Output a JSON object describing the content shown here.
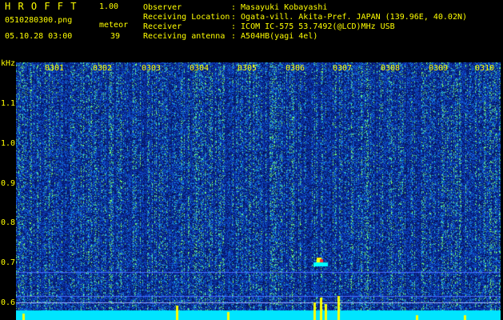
{
  "app": {
    "title": "H R O F F T",
    "version": "1.00",
    "filename": "0510280300.png",
    "datetime": "05.10.28 03:00",
    "meteor_label": "meteor",
    "meteor_count": "39"
  },
  "info": {
    "observer_label": "Observer",
    "observer_value": ": Masayuki Kobayashi",
    "location_label": "Receiving Location",
    "location_value": ": Ogata-vill. Akita-Pref. JAPAN (139.96E, 40.02N)",
    "receiver_label": "Receiver",
    "receiver_value": ": ICOM IC-575 53.7492(@LCD)MHz USB",
    "antenna_label": "Receiving antenna",
    "antenna_value": ": A504HB(yagi 4el)"
  },
  "axis": {
    "unit": "kHz",
    "y_ticks": [
      "1.1",
      "1.0",
      "0.9",
      "0.8",
      "0.7",
      "0.6"
    ],
    "x_ticks": [
      "0301",
      "0302",
      "0303",
      "0304",
      "0305",
      "0306",
      "0307",
      "0308",
      "0309",
      "0310"
    ]
  },
  "colors": {
    "text": "#ffff00",
    "background": "#000000",
    "spectrum_low": "#0a2fa0",
    "spectrum_high": "#00ffff",
    "signal": "#ffff00"
  }
}
